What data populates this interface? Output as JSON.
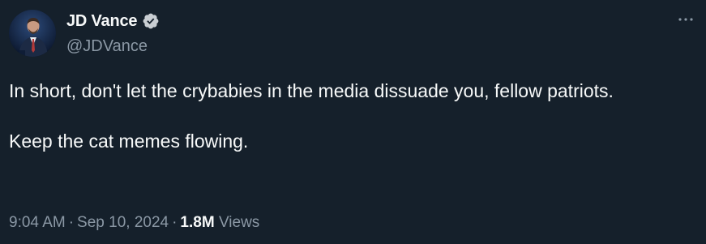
{
  "author": {
    "display_name": "JD Vance",
    "handle": "@JDVance",
    "verified": true
  },
  "menu": {
    "icon": "more-horizontal-icon"
  },
  "tweet": {
    "paragraph_1": "In short, don't let the crybabies in the media dissuade you, fellow patriots.",
    "paragraph_2": "Keep the cat memes flowing."
  },
  "meta": {
    "time": "9:04 AM",
    "separator": "·",
    "date": "Sep 10, 2024",
    "views_count": "1.8M",
    "views_label": "Views"
  },
  "colors": {
    "background": "#15202b",
    "text_primary": "#f7f9f9",
    "text_secondary": "#8b98a5",
    "verified_badge": "#c9ced3"
  }
}
